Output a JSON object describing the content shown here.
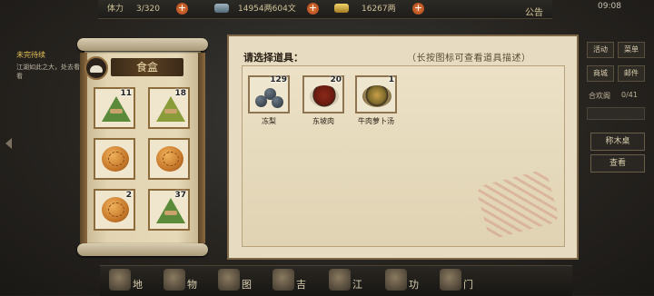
{
  "topbar": {
    "stamina_label": "体力",
    "stamina_value": "3/320",
    "coins": "14954两604文",
    "gold": "16267两",
    "notice": "公告",
    "clock": "09:08"
  },
  "quest": {
    "title": "未完待续",
    "desc": "江湖如此之大，处去看看"
  },
  "foodbox": {
    "title": "食盒",
    "slots": [
      {
        "icon": "zongzi-green-icon",
        "count": "11"
      },
      {
        "icon": "zongzi-yellow-icon",
        "count": "18"
      },
      {
        "icon": "mooncake-icon",
        "count": ""
      },
      {
        "icon": "mooncake-icon",
        "count": ""
      },
      {
        "icon": "mooncake-icon",
        "count": "2"
      },
      {
        "icon": "zongzi-green-icon",
        "count": "37"
      }
    ]
  },
  "dialog": {
    "title": "请选择道具：",
    "hint": "（长按图标可查看道具描述）",
    "items": [
      {
        "icon": "frozen-pear-icon",
        "count": "129",
        "label": "冻梨"
      },
      {
        "icon": "dongpo-pork-icon",
        "count": "20",
        "label": "东坡肉"
      },
      {
        "icon": "beef-radish-soup-icon",
        "count": "1",
        "label": "牛肉萝卜汤"
      }
    ]
  },
  "rightmenu": {
    "btn1": "活动",
    "btn2": "菜单",
    "btn3": "商城",
    "btn4": "邮件",
    "label": "合欢阁",
    "label2": "0/41",
    "action1": "称木桌",
    "action2": "查看"
  },
  "bottombar": {
    "items": [
      "地",
      "物",
      "图",
      "吉",
      "江",
      "功",
      "门"
    ]
  },
  "colors": {
    "accent_orange": "#c6782a",
    "frame_brown": "#8b6a3c",
    "parchment": "#e7dcc1"
  }
}
